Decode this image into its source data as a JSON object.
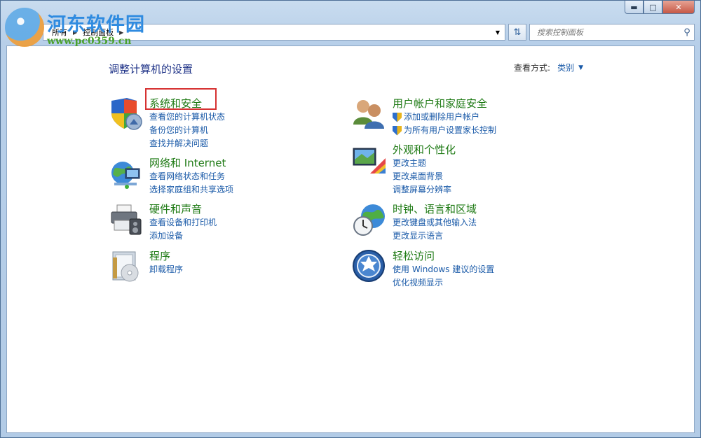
{
  "watermark": {
    "title": "河东软件园",
    "url": "www.pc0359.cn"
  },
  "window": {
    "controls": [
      "minimize",
      "maximize",
      "close"
    ]
  },
  "address": {
    "crumbs": [
      "所有",
      "控制面板"
    ]
  },
  "search": {
    "placeholder": "搜索控制面板"
  },
  "header": {
    "title": "调整计算机的设置",
    "view_by_label": "查看方式:",
    "view_by_value": "类别"
  },
  "categories": [
    {
      "title": "系统和安全",
      "icon": "shield-icon",
      "links": [
        "查看您的计算机状态",
        "备份您的计算机",
        "查找并解决问题"
      ]
    },
    {
      "title": "网络和 Internet",
      "icon": "network-globe-icon",
      "links": [
        "查看网络状态和任务",
        "选择家庭组和共享选项"
      ]
    },
    {
      "title": "硬件和声音",
      "icon": "printer-icon",
      "links": [
        "查看设备和打印机",
        "添加设备"
      ]
    },
    {
      "title": "程序",
      "icon": "programs-icon",
      "links": [
        "卸载程序"
      ]
    },
    {
      "title": "用户帐户和家庭安全",
      "icon": "users-icon",
      "links": [
        "添加或删除用户帐户",
        "为所有用户设置家长控制"
      ]
    },
    {
      "title": "外观和个性化",
      "icon": "monitor-palette-icon",
      "links": [
        "更改主题",
        "更改桌面背景",
        "调整屏幕分辨率"
      ]
    },
    {
      "title": "时钟、语言和区域",
      "icon": "clock-globe-icon",
      "links": [
        "更改键盘或其他输入法",
        "更改显示语言"
      ]
    },
    {
      "title": "轻松访问",
      "icon": "ease-of-access-icon",
      "links": [
        "使用 Windows 建议的设置",
        "优化视频显示"
      ]
    }
  ],
  "colors": {
    "category_title": "#1e7a14",
    "link": "#1a5aa8",
    "page_title": "#1e3287",
    "highlight": "#d63232"
  }
}
